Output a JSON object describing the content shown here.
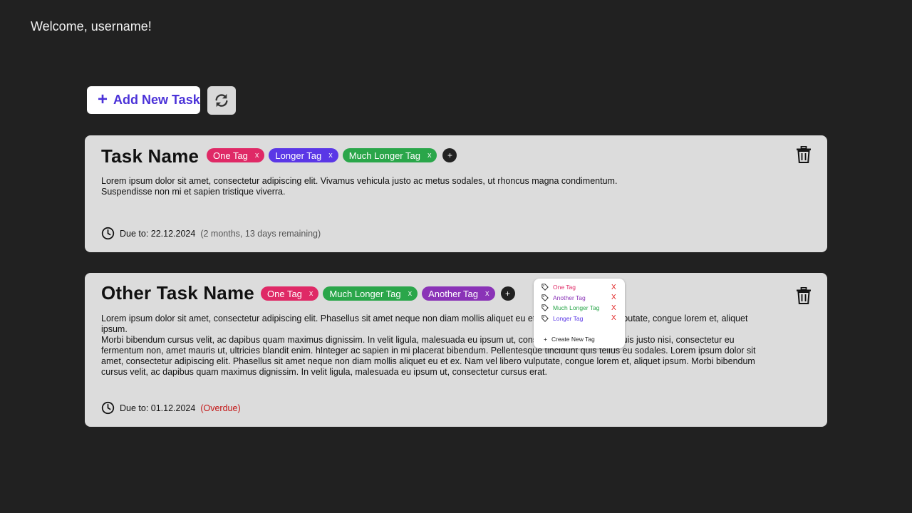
{
  "header": {
    "welcome": "Welcome, username!"
  },
  "toolbar": {
    "add_task_label": "Add New Task",
    "add_task_icon": "plus-icon",
    "refresh_icon": "refresh-icon"
  },
  "colors": {
    "background": "#212121",
    "card": "#dcdcdc",
    "accent": "#4b32d8",
    "tag_pink": "#df2966",
    "tag_blue": "#5a37e6",
    "tag_green": "#2aa64a",
    "tag_purple": "#8a33b7",
    "overdue": "#c41515"
  },
  "tasks": [
    {
      "title": "Task Name",
      "tags": [
        {
          "label": "One Tag",
          "remove": "x",
          "color": "#df2966"
        },
        {
          "label": "Longer Tag",
          "remove": "x",
          "color": "#5a37e6"
        },
        {
          "label": "Much Longer Tag",
          "remove": "x",
          "color": "#2aa64a"
        }
      ],
      "add_tag": "+",
      "description": [
        "Lorem ipsum dolor sit amet, consectetur adipiscing elit. Vivamus  vehicula justo ac metus sodales, ut rhoncus magna condimentum.",
        "Suspendisse non mi et sapien tristique viverra."
      ],
      "due_label": "Due to: 22.12.2024",
      "due_status": "(2 months, 13 days remaining)"
    },
    {
      "title": "Other Task Name",
      "tags": [
        {
          "label": "One Tag",
          "remove": "x",
          "color": "#df2966"
        },
        {
          "label": "Much Longer Tag",
          "remove": "x",
          "color": "#2aa64a"
        },
        {
          "label": "Another Tag",
          "remove": "x",
          "color": "#8a33b7"
        }
      ],
      "add_tag": "+",
      "description": [
        "Lorem ipsum dolor sit amet, consectetur adipiscing elit. Phasellus sit  amet neque non diam mollis aliquet eu et ex. Nam vel libero vulputate,  congue lorem et, aliquet ipsum.",
        "Morbi bibendum cursus velit, ac dapibus  quam maximus dignissim. In velit ligula, malesuada eu ipsum ut,  consectetur cursus erat. Duis justo nisi, consectetur eu fermentum non,  amet mauris  ut, ultricies blandit enim. hInteger ac sapien in mi placerat bibendum.  Pellentesque tincidunt quis tellus eu sodales. Lorem ipsum dolor sit amet, consectetur adipiscing elit. Phasellus sit  amet neque non diam mollis aliquet eu et ex. Nam vel libero vulputate,  congue lorem et, aliquet ipsum. Morbi bibendum cursus velit, ac dapibus  quam maximus dignissim. In velit ligula, malesuada eu ipsum ut,  consectetur cursus erat."
      ],
      "due_label": "Due to: 01.12.2024",
      "due_status": "(Overdue)"
    }
  ],
  "tag_popup": {
    "items": [
      {
        "label": "One Tag",
        "color": "#df2966",
        "remove": "X"
      },
      {
        "label": "Another Tag",
        "color": "#8a33b7",
        "remove": "X"
      },
      {
        "label": "Much Longer Tag",
        "color": "#2aa64a",
        "remove": "X"
      },
      {
        "label": "Longer Tag",
        "color": "#5a37e6",
        "remove": "X"
      }
    ],
    "create_icon": "+",
    "create_label": "Create New Tag"
  }
}
